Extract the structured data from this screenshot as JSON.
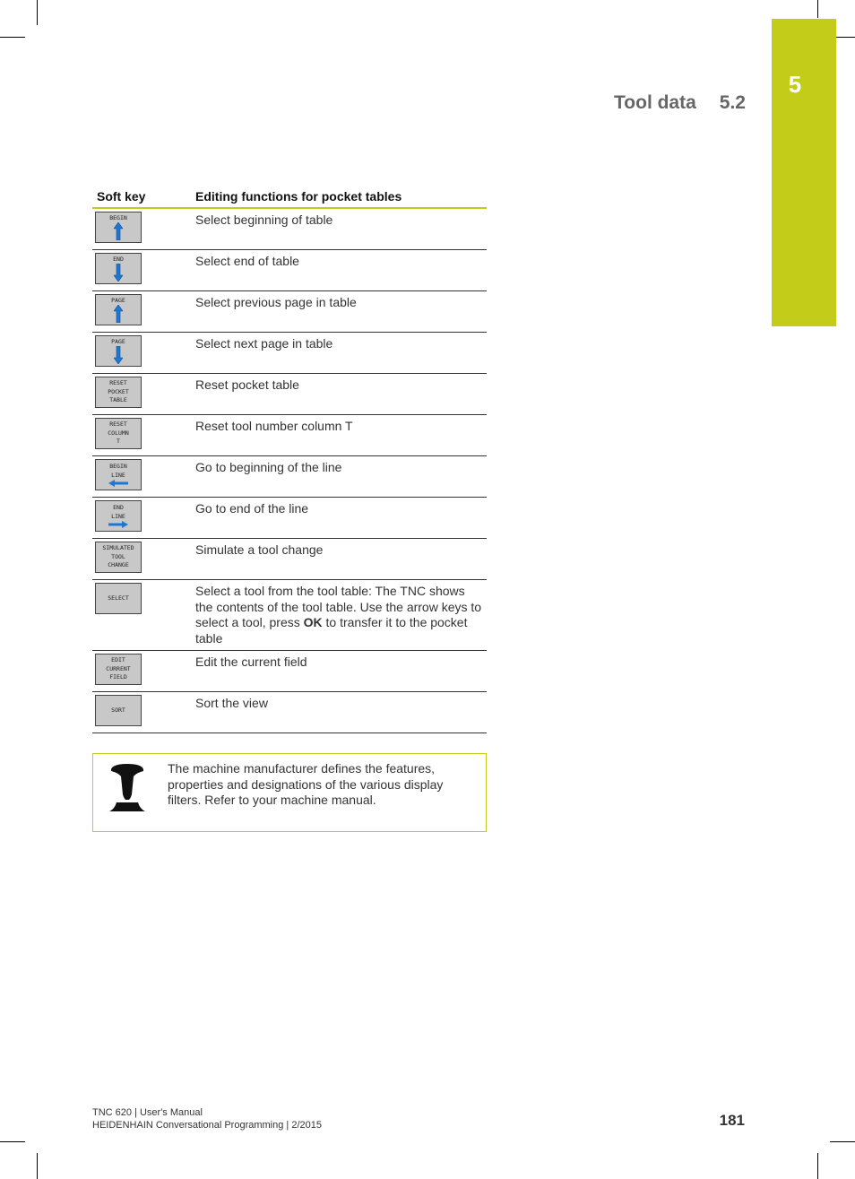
{
  "header": {
    "chapter_number": "5",
    "running_title": "Tool data",
    "section_number": "5.2"
  },
  "table": {
    "col_softkey": "Soft key",
    "col_function": "Editing functions for pocket tables",
    "rows": [
      {
        "key_label": "BEGIN",
        "arrow": "up",
        "description": "Select beginning of table"
      },
      {
        "key_label": "END",
        "arrow": "down",
        "description": "Select end of table"
      },
      {
        "key_label": "PAGE",
        "arrow": "up",
        "description": "Select previous page in table"
      },
      {
        "key_label": "PAGE",
        "arrow": "down",
        "description": "Select next page in table"
      },
      {
        "key_label": "RESET\nPOCKET\nTABLE",
        "arrow": "",
        "description": "Reset pocket table"
      },
      {
        "key_label": "RESET\nCOLUMN\nT",
        "arrow": "",
        "description": "Reset tool number column T"
      },
      {
        "key_label": "BEGIN\nLINE",
        "arrow": "left",
        "description": "Go to beginning of the line"
      },
      {
        "key_label": "END\nLINE",
        "arrow": "right",
        "description": "Go to end of the line"
      },
      {
        "key_label": "SIMULATED\nTOOL\nCHANGE",
        "arrow": "",
        "description": "Simulate a tool change"
      },
      {
        "key_label": "SELECT",
        "arrow": "",
        "description_pre": "Select a tool from the tool table: The TNC shows the contents of the tool table. Use the arrow keys to select a tool, press ",
        "description_bold": "OK",
        "description_post": " to transfer it to the pocket table"
      },
      {
        "key_label": "EDIT\nCURRENT\nFIELD",
        "arrow": "",
        "description": "Edit the current field"
      },
      {
        "key_label": "SORT",
        "arrow": "",
        "description": "Sort the view"
      }
    ]
  },
  "note": {
    "icon": "machine-manufacturer-icon",
    "text": "The machine manufacturer defines the features, properties and designations of the various display filters. Refer to your machine manual."
  },
  "footer": {
    "line1": "TNC 620 | User's Manual",
    "line2": "HEIDENHAIN Conversational Programming | 2/2015",
    "page_number": "181"
  },
  "colors": {
    "accent": "#c3cd19",
    "softkey_bg": "#c8c8c8",
    "arrow_blue": "#1e78d2"
  }
}
